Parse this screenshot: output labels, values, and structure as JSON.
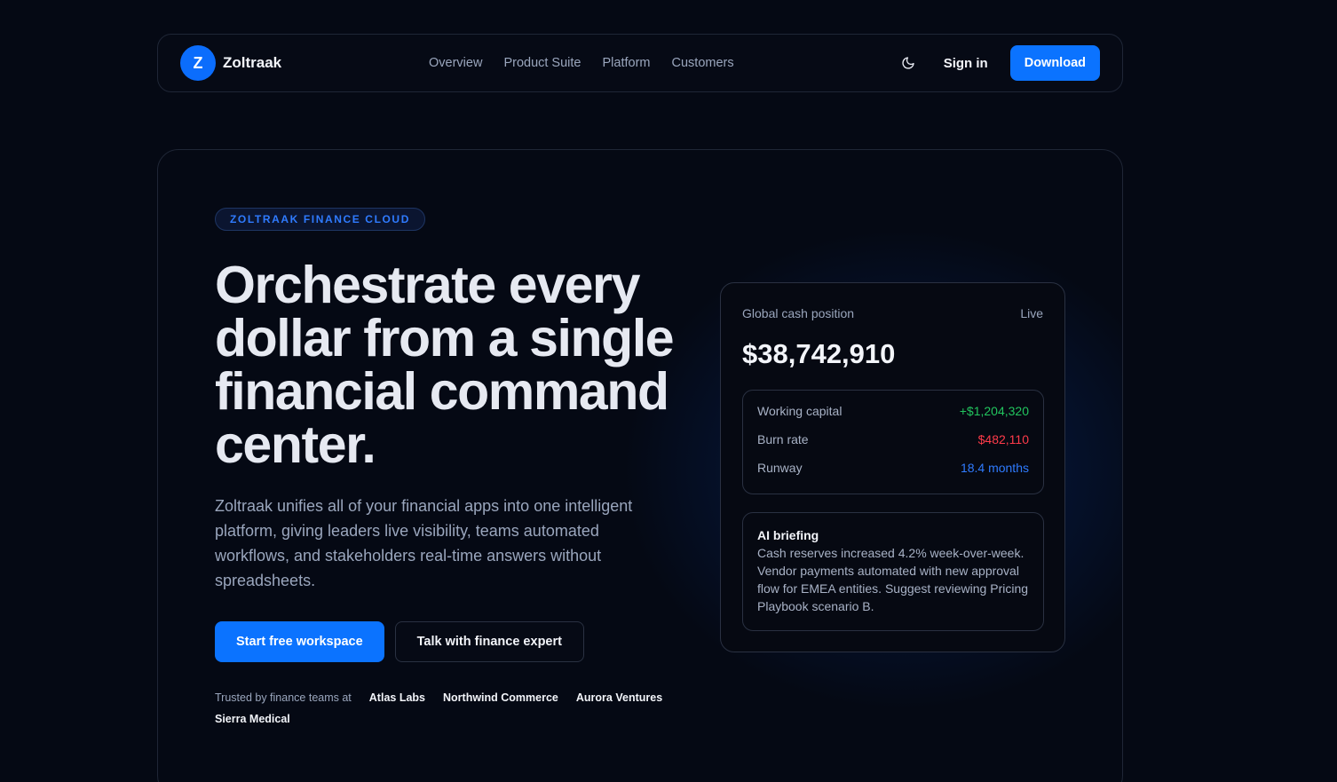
{
  "brand": {
    "mark": "Z",
    "name": "Zoltraak"
  },
  "nav": {
    "links": [
      "Overview",
      "Product Suite",
      "Platform",
      "Customers"
    ],
    "theme_icon": "moon-icon",
    "sign_in": "Sign in",
    "download": "Download"
  },
  "hero": {
    "eyebrow": "ZOLTRAAK FINANCE CLOUD",
    "headline": "Orchestrate every dollar from a single financial command center.",
    "lede": "Zoltraak unifies all of your financial apps into one intelligent platform, giving leaders live visibility, teams automated workflows, and stakeholders real-time answers without spreadsheets.",
    "primary_cta": "Start free workspace",
    "secondary_cta": "Talk with finance expert",
    "trusted_label": "Trusted by finance teams at",
    "companies": [
      "Atlas Labs",
      "Northwind Commerce",
      "Aurora Ventures",
      "Sierra Medical"
    ]
  },
  "card": {
    "title": "Global cash position",
    "status": "Live",
    "amount": "$38,742,910",
    "metrics": [
      {
        "label": "Working capital",
        "value": "+$1,204,320",
        "tone": "#22c55e"
      },
      {
        "label": "Burn rate",
        "value": "$482,110",
        "tone": "#ff3b4a"
      },
      {
        "label": "Runway",
        "value": "18.4 months",
        "tone": "#2f7bff"
      }
    ],
    "briefing_title": "AI briefing",
    "briefing_text": "Cash reserves increased 4.2% week-over-week. Vendor payments automated with new approval flow for EMEA entities. Suggest reviewing Pricing Playbook scenario B."
  },
  "colors": {
    "accent": "#0b73ff",
    "background": "#050914",
    "positive": "#22c55e",
    "negative": "#ff3b4a"
  }
}
